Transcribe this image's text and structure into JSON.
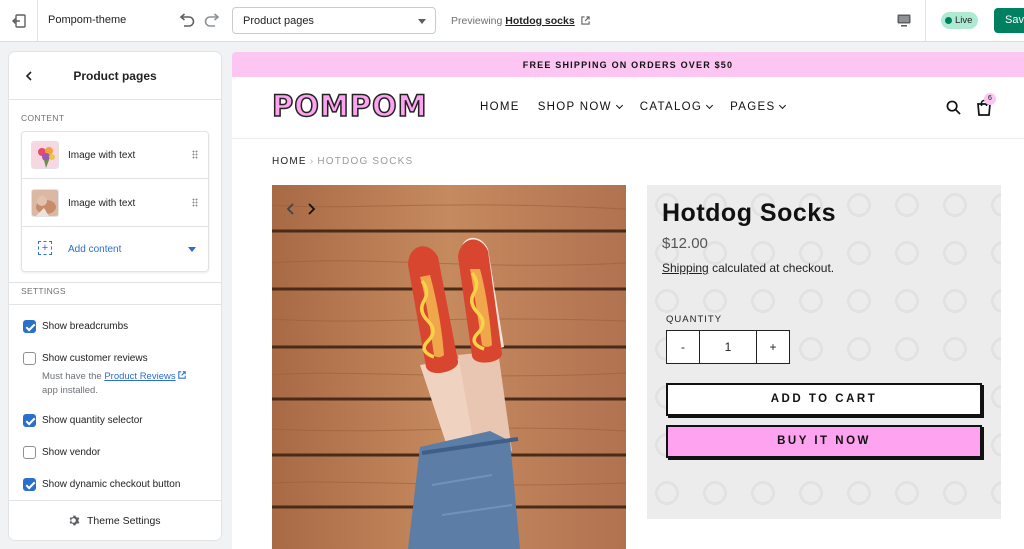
{
  "topbar": {
    "theme_name": "Pompom-theme",
    "template_select": "Product pages",
    "preview_prefix": "Previewing",
    "preview_product": "Hotdog socks",
    "live_label": "Live",
    "save_label": "Save"
  },
  "panel": {
    "title": "Product pages",
    "content_label": "CONTENT",
    "blocks": [
      {
        "label": "Image with text"
      },
      {
        "label": "Image with text"
      }
    ],
    "add_content_label": "Add content",
    "settings_label": "SETTINGS",
    "settings": [
      {
        "label": "Show breadcrumbs",
        "checked": true
      },
      {
        "label": "Show customer reviews",
        "checked": false
      },
      {
        "label": "Show quantity selector",
        "checked": true
      },
      {
        "label": "Show vendor",
        "checked": false
      },
      {
        "label": "Show dynamic checkout button",
        "checked": true
      }
    ],
    "reviews_help_prefix": "Must have the",
    "reviews_help_link": "Product Reviews",
    "reviews_help_suffix": "app installed.",
    "footer_label": "Theme Settings"
  },
  "store": {
    "announcement": "FREE SHIPPING ON ORDERS OVER $50",
    "logo": "POMPOM",
    "nav": [
      {
        "label": "HOME"
      },
      {
        "label": "SHOP NOW"
      },
      {
        "label": "CATALOG"
      },
      {
        "label": "PAGES"
      }
    ],
    "cart_count": "6",
    "breadcrumb_home": "HOME",
    "breadcrumb_sep": "›",
    "breadcrumb_current": "HOTDOG SOCKS",
    "product": {
      "title": "Hotdog Socks",
      "price": "$12.00",
      "shipping_link": "Shipping",
      "shipping_text": "calculated at checkout.",
      "quantity_label": "QUANTITY",
      "quantity_minus": "-",
      "quantity_value": "1",
      "quantity_plus": "+",
      "add_to_cart": "ADD TO CART",
      "buy_now": "BUY IT NOW"
    }
  },
  "colors": {
    "accent_pink": "#fda3ef",
    "announcement_pink": "#fcc5f2",
    "shopify_blue": "#2c6ecb",
    "save_green": "#008060",
    "live_green": "#aee9d1"
  }
}
